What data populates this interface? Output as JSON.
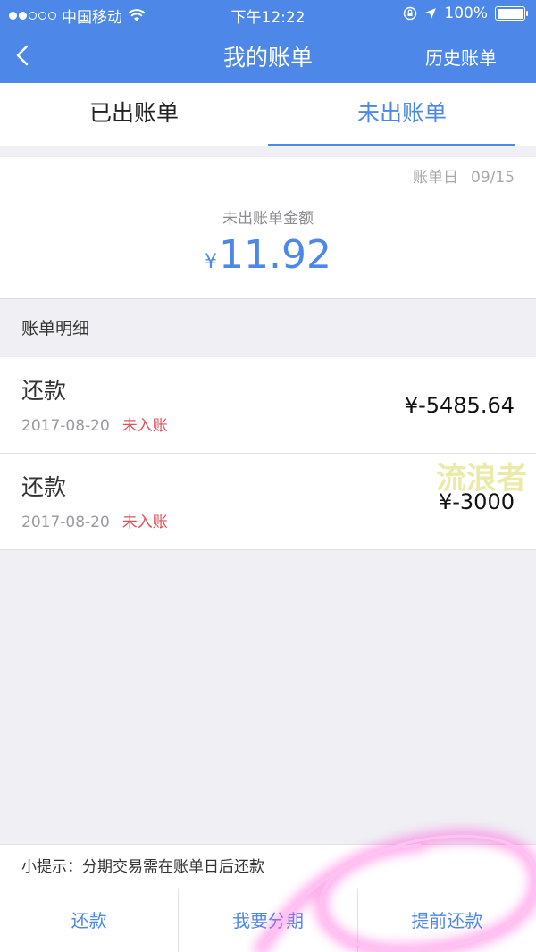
{
  "status_bar": {
    "carrier": "中国移动",
    "time": "下午12:22",
    "battery": "100%"
  },
  "nav": {
    "title": "我的账单",
    "right_action": "历史账单"
  },
  "tabs": [
    {
      "label": "已出账单",
      "active": false
    },
    {
      "label": "未出账单",
      "active": true
    }
  ],
  "summary": {
    "bill_date_label": "账单日",
    "bill_date_value": "09/15",
    "amount_label": "未出账单金额",
    "currency": "¥",
    "amount": "11.92"
  },
  "section": {
    "title": "账单明细"
  },
  "transactions": [
    {
      "type": "还款",
      "date": "2017-08-20",
      "status": "未入账",
      "amount": "¥-5485.64"
    },
    {
      "type": "还款",
      "date": "2017-08-20",
      "status": "未入账",
      "amount": "¥-3000"
    }
  ],
  "watermark": "流浪者",
  "tip": "小提示：分期交易需在账单日后还款",
  "bottom_actions": [
    "还款",
    "我要分期",
    "提前还款"
  ],
  "colors": {
    "primary": "#4d88e8",
    "status_red": "#e0525a",
    "highlight": "#ff4fd8"
  },
  "icons": [
    "wifi-icon",
    "back-chevron-icon",
    "lock-rotation-icon",
    "location-arrow-icon",
    "battery-icon"
  ]
}
